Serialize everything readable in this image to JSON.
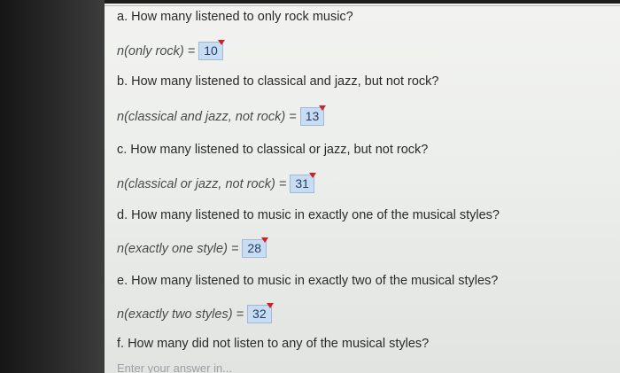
{
  "questions": [
    {
      "question": "a. How many listened to only rock music?",
      "label": "n(only rock) =",
      "answer": "10"
    },
    {
      "question": "b. How many listened to classical and jazz, but not rock?",
      "label": "n(classical and jazz, not rock) =",
      "answer": "13"
    },
    {
      "question": "c. How many listened to classical or jazz, but not rock?",
      "label": "n(classical or jazz, not rock) =",
      "answer": "31"
    },
    {
      "question": "d. How many listened to music in exactly one of the musical styles?",
      "label": "n(exactly one style) =",
      "answer": "28"
    },
    {
      "question": "e. How many listened to music in exactly two of the musical styles?",
      "label": "n(exactly two styles) =",
      "answer": "32"
    },
    {
      "question": "f. How many did not listen to any of the musical styles?"
    }
  ],
  "partial_prompt": "Enter your answer in..."
}
